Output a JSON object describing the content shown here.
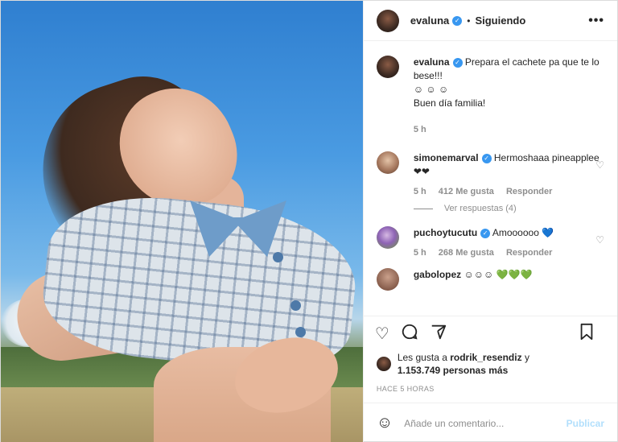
{
  "post": {
    "author": "evaluna",
    "follow_status": "Siguiendo",
    "separator": "•",
    "more_icon": "•••"
  },
  "caption": {
    "author": "evaluna",
    "text": "Prepara el cachete pa que te lo bese!!!",
    "emojis": "☺ ☺ ☺",
    "line2": "Buen día familia!",
    "time": "5 h"
  },
  "comments": [
    {
      "user": "simonemarval",
      "text": "Hermoshaaa pineapplee ❤❤",
      "time": "5 h",
      "likes": "412 Me gusta",
      "reply": "Responder",
      "view_replies": "Ver respuestas (4)"
    },
    {
      "user": "puchoytucutu",
      "text": "Amoooooo 💙",
      "time": "5 h",
      "likes": "268 Me gusta",
      "reply": "Responder"
    },
    {
      "user": "gabolopez",
      "text": "☺☺☺ 💚💚💚"
    }
  ],
  "likes_text": {
    "prefix": "Les gusta a",
    "user": "rodrik_resendiz",
    "suffix": "y",
    "count": "1.153.749 personas más"
  },
  "timestamp": "HACE 5 HORAS",
  "add_comment": {
    "placeholder": "Añade un comentario...",
    "publish": "Publicar"
  },
  "icons": [
    "heart-icon",
    "comment-icon",
    "share-icon",
    "bookmark-icon",
    "smile-icon",
    "more-icon",
    "verified-icon"
  ],
  "colors": {
    "accent": "#3897f0",
    "publish_disabled": "#b2dffc",
    "muted": "#8e8e8e"
  }
}
